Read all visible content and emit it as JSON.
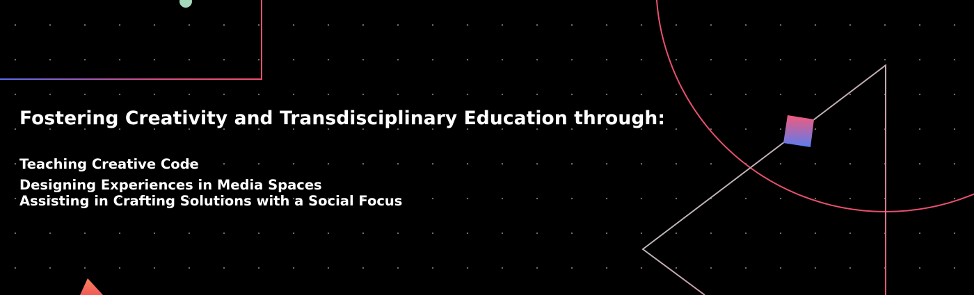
{
  "headline": "Fostering Creativity and Transdisciplinary Education through:",
  "items": [
    "Teaching Creative Code",
    "Designing Experiences in Media Spaces",
    "Assisting in Crafting Solutions with a Social Focus"
  ],
  "colors": {
    "background": "#000000",
    "dots": "#969696",
    "text": "#ffffff",
    "pink": "#e8506e",
    "blue": "#5a7cf0",
    "mint": "#9fe0c2",
    "orange": "#f4704a"
  },
  "decorations": [
    "outlined-rectangle",
    "green-circle",
    "large-circle-outline",
    "triangle-outline",
    "gradient-square",
    "orange-triangle",
    "dot-grid"
  ]
}
